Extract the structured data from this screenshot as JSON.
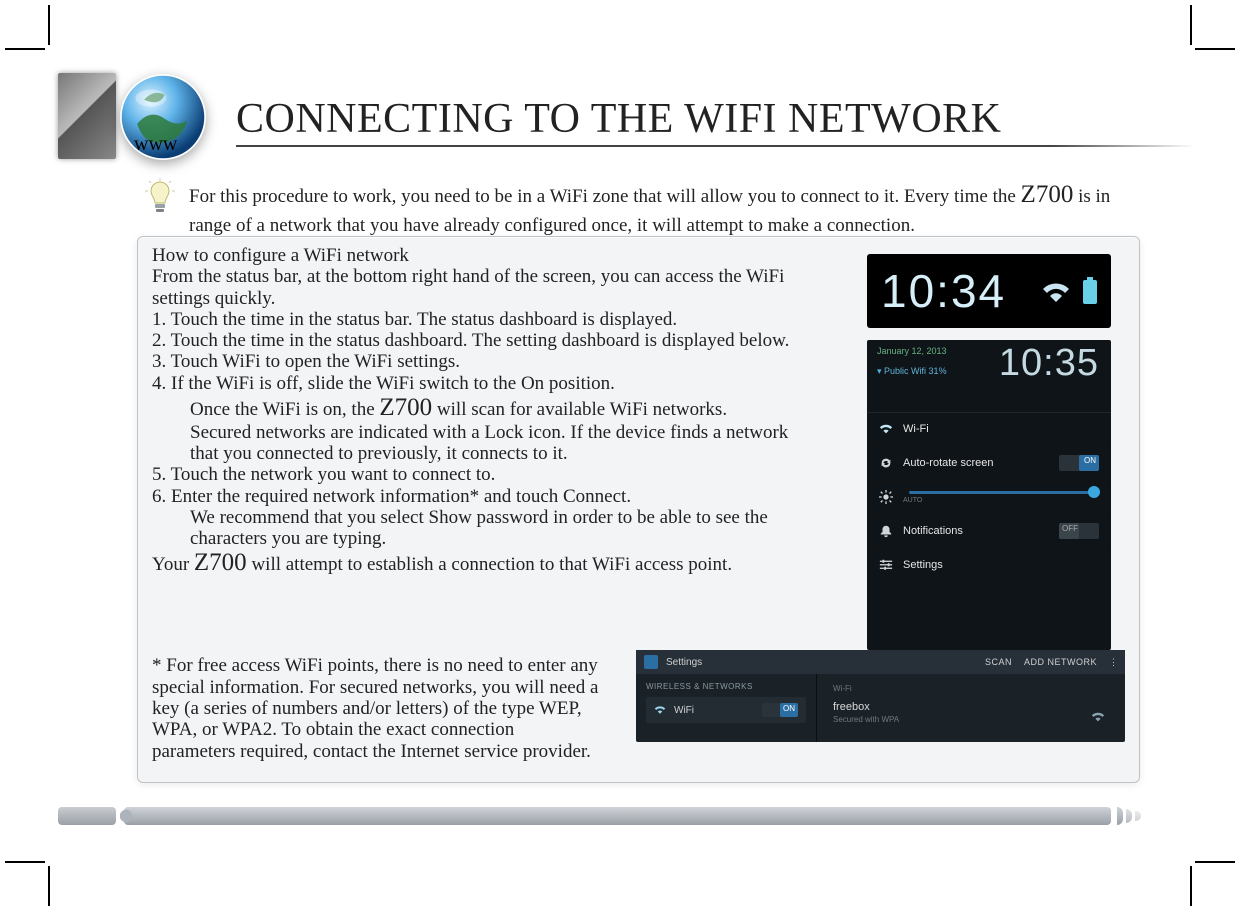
{
  "header": {
    "www_label": "www",
    "title": "CONNECTING TO THE WIFI NETWORK"
  },
  "intro": {
    "text_before": "For this procedure to work, you need to be in a WiFi zone that will allow you to connect to it. Every time the ",
    "chip": "Z700",
    "text_after": " is in range of a network that you have already configured once, it will attempt to make a connection."
  },
  "instructions": {
    "heading": "How to configure a WiFi network",
    "preamble": "From the status bar, at the bottom right hand of the screen, you can access the WiFi settings quickly.",
    "step1": "1. Touch the time in the status bar. The status dashboard is displayed.",
    "step2": "2. Touch the time in the status dashboard. The setting dashboard is displayed below.",
    "step3": "3. Touch WiFi to open the WiFi settings.",
    "step4": "4. If the WiFi is off, slide the WiFi switch to the On position.",
    "step4_sub_a_before": "Once the WiFi is on, the ",
    "step4_sub_a_chip": "Z700",
    "step4_sub_a_after": " will scan for available WiFi networks.",
    "step4_sub_b": "Secured networks are indicated with a Lock icon. If the device finds a network that you connected to previously, it connects to it.",
    "step5": "5. Touch the network you want to connect to.",
    "step6": "6. Enter the required network information* and touch Connect.",
    "step6_sub": "We recommend that you select Show password in order to be able to see the characters you are typing.",
    "closing_before": "Your ",
    "closing_chip": "Z700",
    "closing_after": " will attempt to establish a connection to that WiFi access point.",
    "footnote": "* For free access WiFi points, there is no need to enter any special information. For secured networks, you will need a key (a series of numbers and/or letters) of the type WEP, WPA, or WPA2. To obtain the exact connection parameters required, contact the Internet service provider."
  },
  "screenshots": {
    "statusbar": {
      "time": "10:34"
    },
    "dashboard": {
      "date": "January 12, 2013",
      "time": "10:35",
      "network_line": "Public Wifi   31%",
      "rows": {
        "wifi": "Wi-Fi",
        "autorotate": "Auto-rotate screen",
        "brightness_sub": "AUTO",
        "notifications": "Notifications",
        "settings": "Settings"
      }
    },
    "settings": {
      "title": "Settings",
      "scan": "SCAN",
      "add": "ADD NETWORK",
      "section": "WIRELESS & NETWORKS",
      "wifi": "WiFi",
      "toggle": "ON",
      "ssid": "freebox",
      "ssid_sub": "Secured with WPA"
    }
  }
}
